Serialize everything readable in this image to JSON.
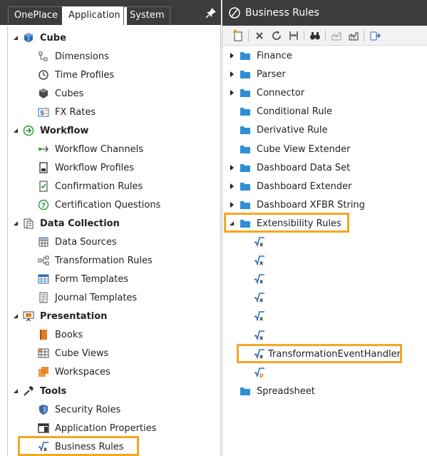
{
  "left_panel": {
    "tabs": [
      "OnePlace",
      "Application",
      "System"
    ],
    "active_tab": "Application",
    "pin_icon": "pin-icon",
    "tree": {
      "cube": {
        "label": "Cube",
        "items": [
          "Dimensions",
          "Time Profiles",
          "Cubes",
          "FX Rates"
        ]
      },
      "workflow": {
        "label": "Workflow",
        "items": [
          "Workflow Channels",
          "Workflow Profiles",
          "Confirmation Rules",
          "Certification Questions"
        ]
      },
      "data_collection": {
        "label": "Data Collection",
        "items": [
          "Data Sources",
          "Transformation Rules",
          "Form Templates",
          "Journal Templates"
        ]
      },
      "presentation": {
        "label": "Presentation",
        "items": [
          "Books",
          "Cube Views",
          "Workspaces"
        ]
      },
      "tools": {
        "label": "Tools",
        "items": [
          "Security Roles",
          "Application Properties",
          "Business Rules"
        ]
      }
    }
  },
  "right_panel": {
    "title": "Business Rules",
    "folders": [
      "Finance",
      "Parser",
      "Connector",
      "Conditional Rule",
      "Derivative Rule",
      "Cube View Extender",
      "Dashboard Data Set",
      "Dashboard Extender",
      "Dashboard XFBR String",
      "Extensibility Rules"
    ],
    "extensibility_children": [
      "TransformationEventHandler"
    ],
    "last_folder": "Spreadsheet"
  },
  "colors": {
    "highlight": "#f5a623",
    "tabbar": "#3c3c3c",
    "folder": "#2e8fd6"
  }
}
